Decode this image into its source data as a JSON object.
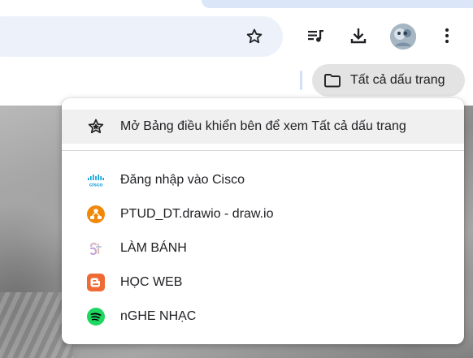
{
  "toolbar": {
    "icons": [
      "bookmark-star-icon",
      "media-queue-icon",
      "download-icon",
      "avatar",
      "more-vert-icon"
    ]
  },
  "bookmarks_bar": {
    "all_bookmarks_label": "Tất cả dấu trang"
  },
  "menu": {
    "open_panel_label": "Mở Bảng điều khiển bên để xem Tất cả dấu trang",
    "items": [
      {
        "label": "Đăng nhập vào Cisco",
        "icon": "cisco-icon",
        "color": "#049fd9"
      },
      {
        "label": "PTUD_DT.drawio - draw.io",
        "icon": "drawio-icon",
        "color": "#f08705"
      },
      {
        "label": "LÀM BÁNH",
        "icon": "lam-banh-favicon",
        "color": "#d7b3c9"
      },
      {
        "label": "HỌC WEB",
        "icon": "blogger-icon",
        "color": "#f06a35"
      },
      {
        "label": "nGHE NHẠC",
        "icon": "spotify-icon",
        "color": "#1ed760"
      }
    ]
  },
  "colors": {
    "accent": "#dbe6f8",
    "omnibox": "#edf2fa",
    "pill": "#e3e3e3",
    "highlight": "#f0f0f0"
  }
}
